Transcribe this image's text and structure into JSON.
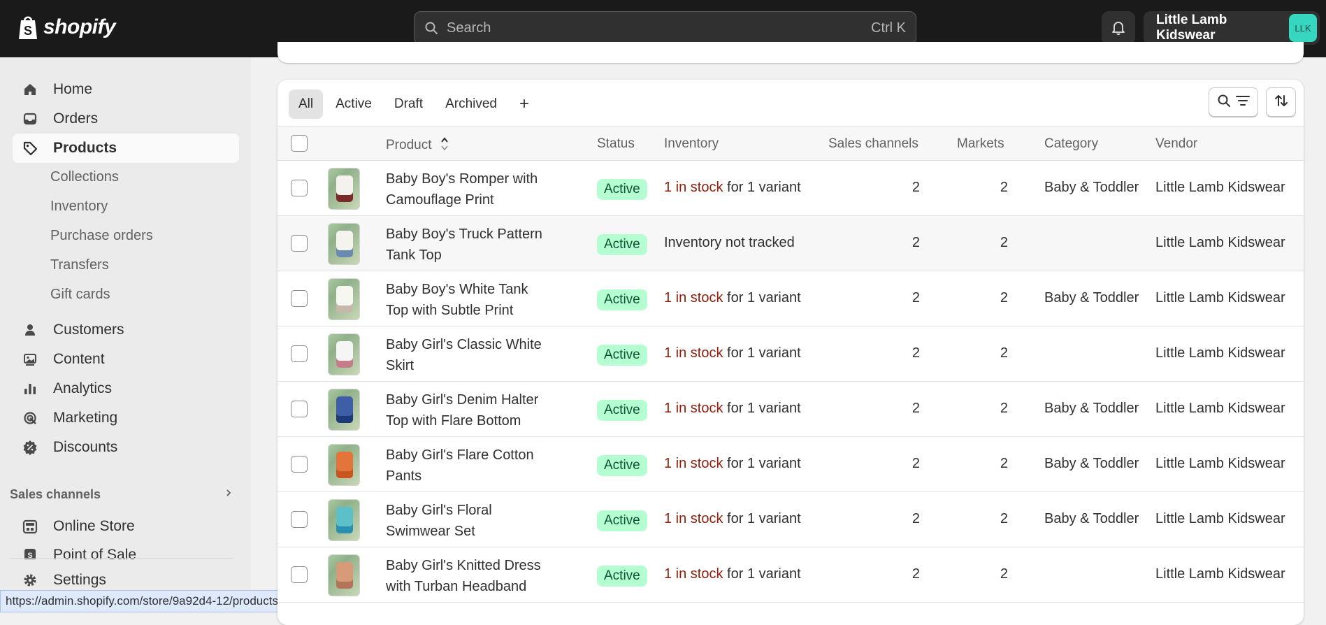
{
  "topbar": {
    "brand": "shopify",
    "search_placeholder": "Search",
    "search_shortcut": "Ctrl K",
    "account_name": "Little Lamb Kidswear",
    "account_initials": "LLK"
  },
  "sidebar": {
    "main": [
      {
        "label": "Home",
        "icon": "home-icon"
      },
      {
        "label": "Orders",
        "icon": "orders-inbox-icon"
      },
      {
        "label": "Products",
        "icon": "product-tag-icon"
      }
    ],
    "products_sub": [
      "Collections",
      "Inventory",
      "Purchase orders",
      "Transfers",
      "Gift cards"
    ],
    "more": [
      {
        "label": "Customers",
        "icon": "person-icon"
      },
      {
        "label": "Content",
        "icon": "content-image-icon"
      },
      {
        "label": "Analytics",
        "icon": "bar-chart-icon"
      },
      {
        "label": "Marketing",
        "icon": "target-icon"
      },
      {
        "label": "Discounts",
        "icon": "discount-badge-icon"
      }
    ],
    "sales_channels_label": "Sales channels",
    "channels": [
      {
        "label": "Online Store",
        "icon": "store-icon"
      },
      {
        "label": "Point of Sale",
        "icon": "pos-icon"
      }
    ],
    "settings_label": "Settings"
  },
  "status_url": "https://admin.shopify.com/store/9a92d4-12/products",
  "tabs": [
    "All",
    "Active",
    "Draft",
    "Archived"
  ],
  "tab_add": "+",
  "table": {
    "headers": {
      "product": "Product",
      "status": "Status",
      "inventory": "Inventory",
      "sales_channels": "Sales channels",
      "markets": "Markets",
      "category": "Category",
      "vendor": "Vendor"
    },
    "rows": [
      {
        "name": "Baby Boy's Romper with Camouflage Print",
        "status": "Active",
        "stock": "1 in stock",
        "inv_rest": " for 1 variant",
        "channels": "2",
        "markets": "2",
        "category": "Baby & Toddler",
        "vendor": "Little Lamb Kidswear"
      },
      {
        "name": "Baby Boy's Truck Pattern Tank Top",
        "status": "Active",
        "stock": "",
        "inv_rest": "Inventory not tracked",
        "channels": "2",
        "markets": "2",
        "category": "",
        "vendor": "Little Lamb Kidswear"
      },
      {
        "name": "Baby Boy's White Tank Top with Subtle Print",
        "status": "Active",
        "stock": "1 in stock",
        "inv_rest": " for 1 variant",
        "channels": "2",
        "markets": "2",
        "category": "Baby & Toddler",
        "vendor": "Little Lamb Kidswear"
      },
      {
        "name": "Baby Girl's Classic White Skirt",
        "status": "Active",
        "stock": "1 in stock",
        "inv_rest": " for 1 variant",
        "channels": "2",
        "markets": "2",
        "category": "",
        "vendor": "Little Lamb Kidswear"
      },
      {
        "name": "Baby Girl's Denim Halter Top with Flare Bottom",
        "status": "Active",
        "stock": "1 in stock",
        "inv_rest": " for 1 variant",
        "channels": "2",
        "markets": "2",
        "category": "Baby & Toddler",
        "vendor": "Little Lamb Kidswear"
      },
      {
        "name": "Baby Girl's Flare Cotton Pants",
        "status": "Active",
        "stock": "1 in stock",
        "inv_rest": " for 1 variant",
        "channels": "2",
        "markets": "2",
        "category": "Baby & Toddler",
        "vendor": "Little Lamb Kidswear"
      },
      {
        "name": "Baby Girl's Floral Swimwear Set",
        "status": "Active",
        "stock": "1 in stock",
        "inv_rest": " for 1 variant",
        "channels": "2",
        "markets": "2",
        "category": "Baby & Toddler",
        "vendor": "Little Lamb Kidswear"
      },
      {
        "name": "Baby Girl's Knitted Dress with Turban Headband",
        "status": "Active",
        "stock": "1 in stock",
        "inv_rest": " for 1 variant",
        "channels": "2",
        "markets": "2",
        "category": "",
        "vendor": "Little Lamb Kidswear"
      }
    ]
  },
  "colors": {
    "topbar": "#1a1a1a",
    "active_badge_bg": "#b4fed2",
    "active_badge_text": "#0c5132",
    "low_stock_text": "#8e1f0b",
    "avatar_bg": "#37d6c0"
  }
}
